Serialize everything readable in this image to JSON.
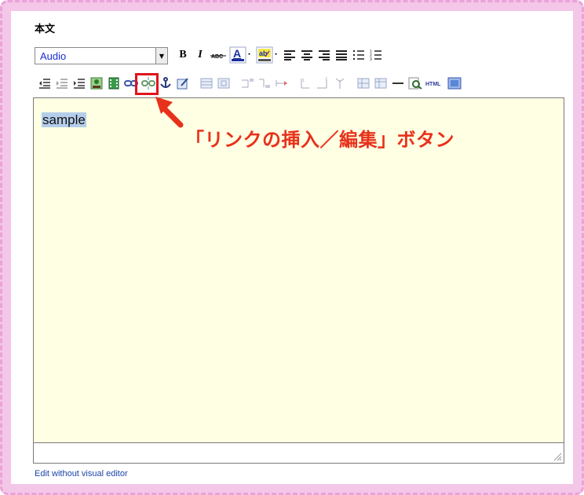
{
  "editor": {
    "heading": "本文",
    "format_select": {
      "value": "Audio"
    },
    "content_text": "sample",
    "edit_link": "Edit without visual editor"
  },
  "toolbar": {
    "row1": [
      {
        "name": "bold-icon",
        "glyph": "B"
      },
      {
        "name": "italic-icon",
        "glyph": "I"
      },
      {
        "name": "strikethrough-icon",
        "glyph": "ABC"
      },
      {
        "name": "text-color-icon",
        "glyph": "A"
      },
      {
        "name": "background-color-icon",
        "glyph": "ab"
      },
      {
        "name": "align-left-icon"
      },
      {
        "name": "align-center-icon"
      },
      {
        "name": "align-right-icon"
      },
      {
        "name": "align-justify-icon"
      },
      {
        "name": "bullet-list-icon"
      },
      {
        "name": "numbered-list-icon"
      }
    ],
    "row2": [
      "outdent-icon",
      "indent-icon",
      "blockquote-icon",
      "image-icon",
      "media-icon",
      "link-icon",
      "unlink-icon",
      "anchor-icon",
      "cleanup-icon",
      "table-icon",
      "table-props-icon",
      "insert-row-icon",
      "insert-col-icon",
      "delete-row-icon",
      "merge-cells-icon",
      "split-cells-icon",
      "delete-col-icon",
      "table-cell-icon",
      "table-row-icon",
      "horizontal-rule-icon",
      "preview-icon",
      "html-icon",
      "fullscreen-icon"
    ],
    "html_label": "HTML"
  },
  "annotation": {
    "text": "「リンクの挿入／編集」ボタン",
    "color": "#e8311a",
    "highlight_color": "#e0141c"
  },
  "colors": {
    "frame": "#f4c6e8",
    "editor_bg": "#ffffe4",
    "selection": "#b4cdea",
    "link": "#1b44a8"
  }
}
